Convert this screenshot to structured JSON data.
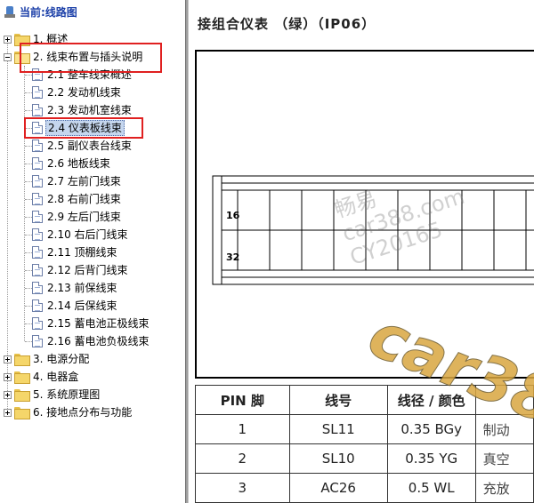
{
  "tree": {
    "root": "当前:线路图",
    "folders_top": [
      {
        "label": "1. 概述",
        "expanded": false
      },
      {
        "label": "2. 线束布置与插头说明",
        "expanded": true
      }
    ],
    "children": [
      "2.1 整车线束概述",
      "2.2 发动机线束",
      "2.3 发动机室线束",
      "2.4 仪表板线束",
      "2.5 副仪表台线束",
      "2.6 地板线束",
      "2.7 左前门线束",
      "2.8 右前门线束",
      "2.9 左后门线束",
      "2.10 右后门线束",
      "2.11 顶棚线束",
      "2.12 后背门线束",
      "2.13 前保线束",
      "2.14 后保线束",
      "2.15 蓄电池正极线束",
      "2.16 蓄电池负极线束"
    ],
    "selected_index": 3,
    "folders_bottom": [
      "3. 电源分配",
      "4. 电器盒",
      "5. 系统原理图",
      "6. 接地点分布与功能"
    ]
  },
  "content": {
    "title": "接组合仪表 （绿）（IP06）",
    "connector": {
      "pin_label_top": "16",
      "pin_label_bottom": "32"
    },
    "watermark_main": "car38",
    "watermark_faint": "畅易\ncar388.com\nCY20165",
    "table": {
      "headers": [
        "PIN 脚",
        "线号",
        "线径 / 颜色",
        ""
      ],
      "rows": [
        [
          "1",
          "SL11",
          "0.35 BGy",
          "制动"
        ],
        [
          "2",
          "SL10",
          "0.35 YG",
          "真空"
        ],
        [
          "3",
          "AC26",
          "0.5 WL",
          "充放"
        ]
      ]
    }
  },
  "colors": {
    "root_title": "#1b3fa8",
    "highlight_box": "#e02020",
    "selection": "#c5d6ee"
  }
}
